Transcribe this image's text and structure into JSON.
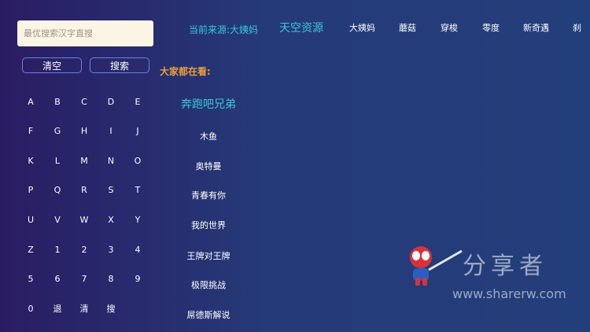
{
  "search": {
    "placeholder": "最优搜索汉字直搜"
  },
  "actions": {
    "clear_label": "清空",
    "search_label": "搜索"
  },
  "keypad": {
    "rows": [
      [
        "A",
        "B",
        "C",
        "D",
        "E"
      ],
      [
        "F",
        "G",
        "H",
        "I",
        "J"
      ],
      [
        "K",
        "L",
        "M",
        "N",
        "O"
      ],
      [
        "P",
        "Q",
        "R",
        "S",
        "T"
      ],
      [
        "U",
        "V",
        "W",
        "X",
        "Y"
      ],
      [
        "Z",
        "1",
        "2",
        "3",
        "4"
      ],
      [
        "5",
        "6",
        "7",
        "8",
        "9"
      ],
      [
        "0",
        "退",
        "清",
        "搜"
      ]
    ]
  },
  "source": {
    "current_label": "当前来源:大姨妈"
  },
  "tabs": [
    {
      "label": "天空资源",
      "active": true
    },
    {
      "label": "大姨妈"
    },
    {
      "label": "蘑菇"
    },
    {
      "label": "穿梭"
    },
    {
      "label": "零度"
    },
    {
      "label": "新奇遇"
    },
    {
      "label": "刹"
    }
  ],
  "hot": {
    "title": "大家都在看:",
    "items": [
      "奔跑吧兄弟",
      "木鱼",
      "奥特曼",
      "青春有你",
      "我的世界",
      "王牌对王牌",
      "极限挑战",
      "屌德斯解说"
    ]
  },
  "watermark": {
    "text": "分享者",
    "url": "www.sharerw.com"
  },
  "colors": {
    "accent": "#36c9d6",
    "hot_title": "#e99d3e",
    "button_border": "#6f7fe0"
  }
}
